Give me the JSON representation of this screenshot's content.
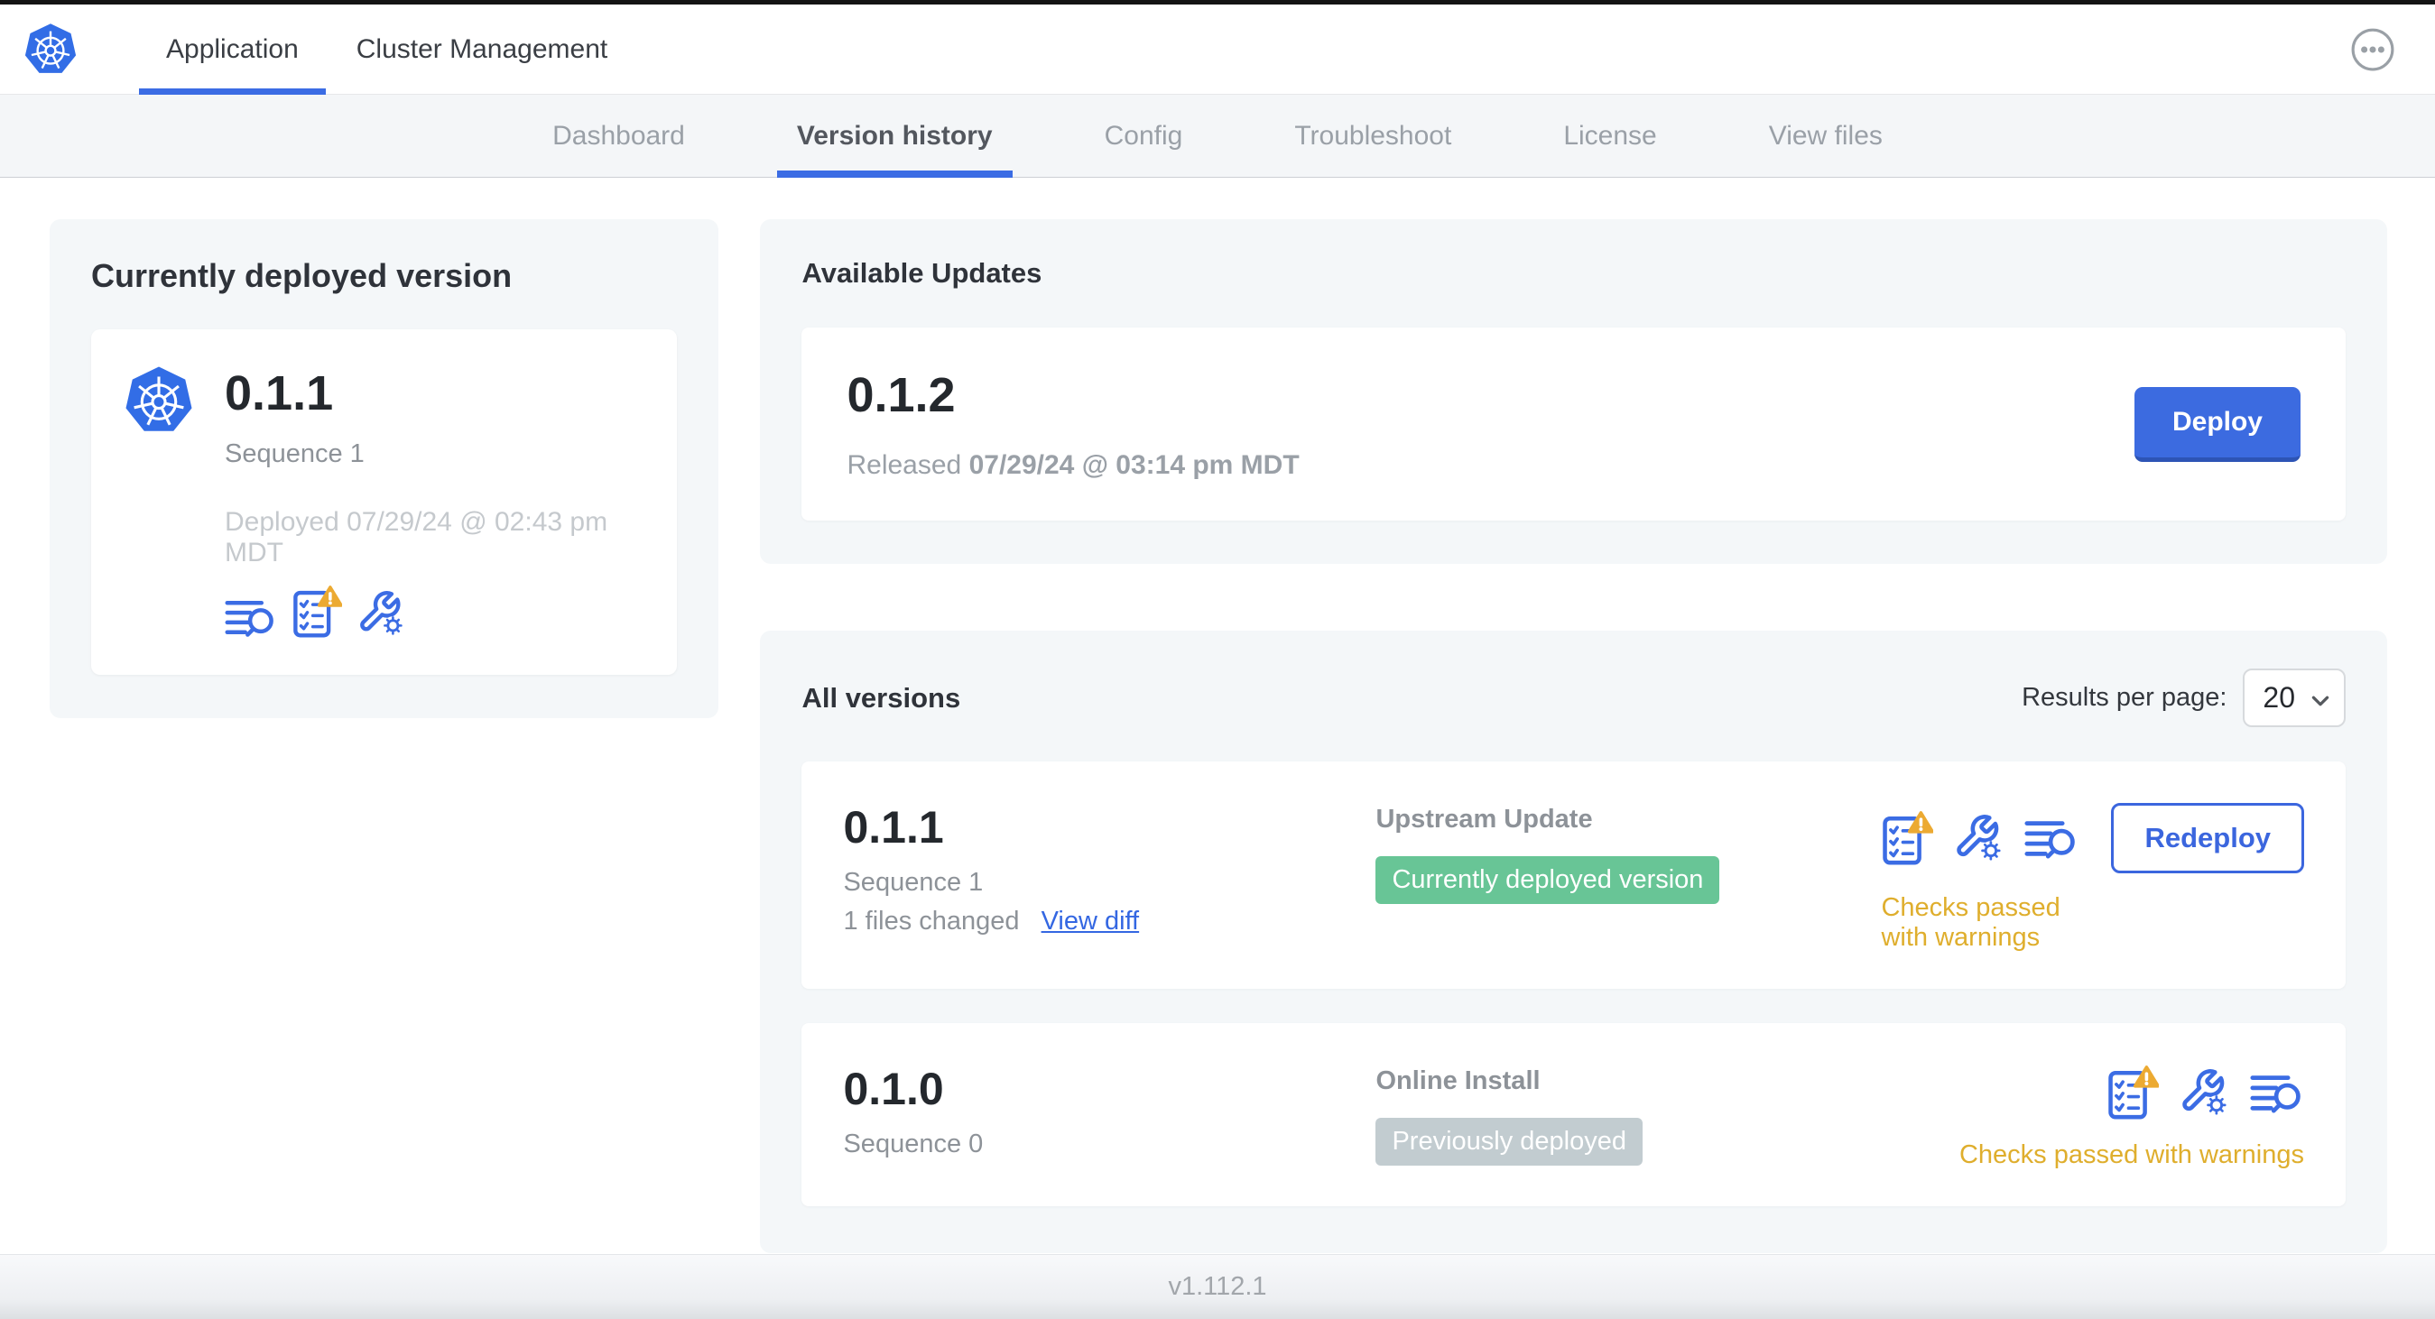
{
  "colors": {
    "accent_blue": "#3b6ce4",
    "logo_blue": "#326de6",
    "warning_amber": "#dfae2d",
    "badge_green": "#68c596",
    "badge_gray": "#c2ccd0"
  },
  "header": {
    "logo_icon": "kubernetes-logo",
    "overflow_menu_icon": "ellipsis-icon",
    "tabs": [
      {
        "label": "Application",
        "active": true
      },
      {
        "label": "Cluster Management",
        "active": false
      }
    ]
  },
  "subnav": {
    "items": [
      {
        "label": "Dashboard",
        "active": false
      },
      {
        "label": "Version history",
        "active": true
      },
      {
        "label": "Config",
        "active": false
      },
      {
        "label": "Troubleshoot",
        "active": false
      },
      {
        "label": "License",
        "active": false
      },
      {
        "label": "View files",
        "active": false
      }
    ]
  },
  "current_version": {
    "title": "Currently deployed version",
    "version": "0.1.1",
    "sequence": "Sequence 1",
    "deployed": "Deployed 07/29/24 @ 02:43 pm MDT",
    "icons": [
      "diff-icon",
      "preflight-checks-warning-icon",
      "config-icon"
    ]
  },
  "available_updates": {
    "title": "Available Updates",
    "version": "0.1.2",
    "released_label": "Released",
    "released_date": "07/29/24 @ 03:14 pm MDT",
    "deploy_button": "Deploy"
  },
  "all_versions": {
    "title": "All versions",
    "results_per_page_label": "Results per page:",
    "results_per_page": "20",
    "rows": [
      {
        "version": "0.1.1",
        "sequence": "Sequence 1",
        "files_changed": "1 files changed",
        "view_diff": "View diff",
        "source": "Upstream Update",
        "badge": "Currently deployed version",
        "badge_style": "green",
        "icons": [
          "preflight-checks-warning-icon",
          "config-icon",
          "diff-icon"
        ],
        "action_button": "Redeploy",
        "status": "Checks passed with warnings"
      },
      {
        "version": "0.1.0",
        "sequence": "Sequence 0",
        "source": "Online Install",
        "badge": "Previously deployed",
        "badge_style": "gray",
        "icons": [
          "preflight-checks-warning-icon",
          "config-icon",
          "diff-icon"
        ],
        "status": "Checks passed with warnings"
      }
    ]
  },
  "footer": {
    "app_version": "v1.112.1"
  }
}
